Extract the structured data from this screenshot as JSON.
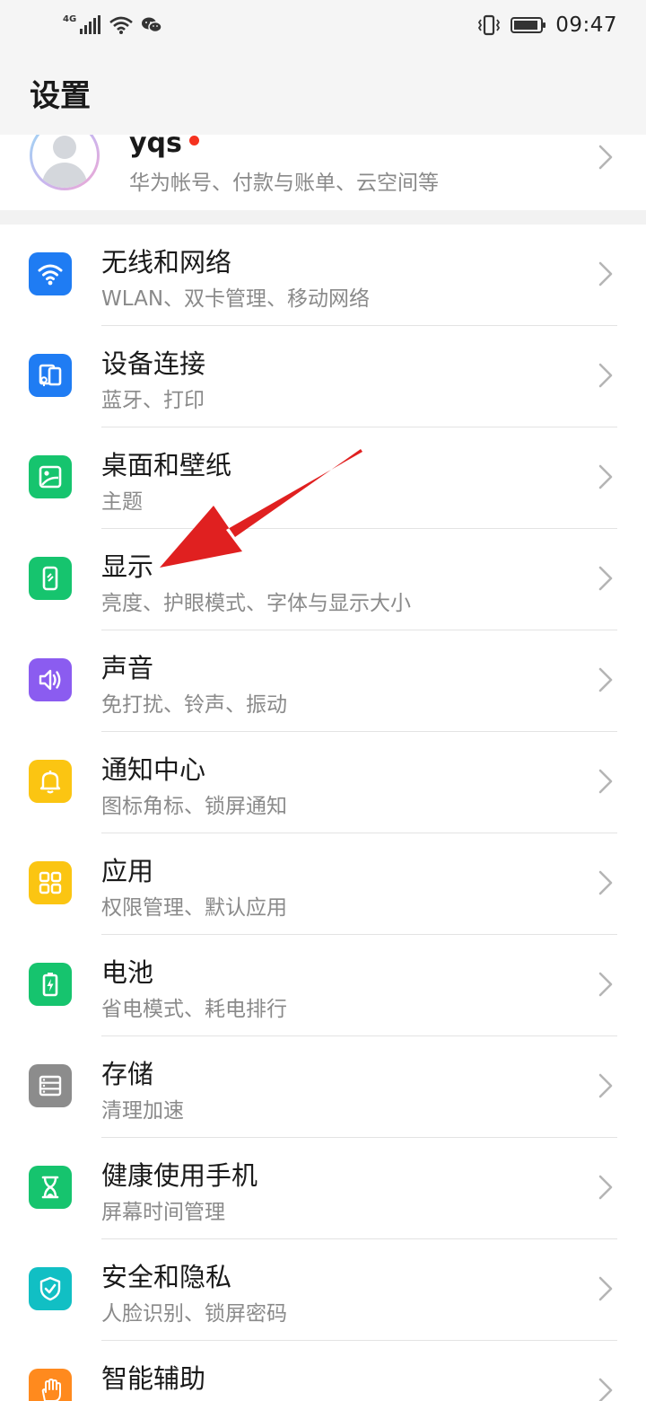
{
  "status_bar": {
    "network_label": "4G",
    "time": "09:47",
    "icons": [
      "signal-icon",
      "wifi-icon",
      "wechat-icon",
      "vibrate-icon",
      "battery-icon"
    ]
  },
  "header": {
    "title": "设置"
  },
  "account": {
    "name": "yqs",
    "subtitle": "华为帐号、付款与账单、云空间等",
    "has_notification_dot": true
  },
  "settings": [
    {
      "title": "无线和网络",
      "subtitle": "WLAN、双卡管理、移动网络",
      "icon": "wifi-icon",
      "color": "#1f7cf3"
    },
    {
      "title": "设备连接",
      "subtitle": "蓝牙、打印",
      "icon": "device-connect-icon",
      "color": "#1f7cf3"
    },
    {
      "title": "桌面和壁纸",
      "subtitle": "主题",
      "icon": "wallpaper-icon",
      "color": "#16c46e"
    },
    {
      "title": "显示",
      "subtitle": "亮度、护眼模式、字体与显示大小",
      "icon": "display-icon",
      "color": "#16c46e"
    },
    {
      "title": "声音",
      "subtitle": "免打扰、铃声、振动",
      "icon": "sound-icon",
      "color": "#8b5cf0"
    },
    {
      "title": "通知中心",
      "subtitle": "图标角标、锁屏通知",
      "icon": "notification-bell-icon",
      "color": "#fbc512"
    },
    {
      "title": "应用",
      "subtitle": "权限管理、默认应用",
      "icon": "apps-grid-icon",
      "color": "#fbc512"
    },
    {
      "title": "电池",
      "subtitle": "省电模式、耗电排行",
      "icon": "battery-charge-icon",
      "color": "#16c46e"
    },
    {
      "title": "存储",
      "subtitle": "清理加速",
      "icon": "storage-icon",
      "color": "#8c8c8c"
    },
    {
      "title": "健康使用手机",
      "subtitle": "屏幕时间管理",
      "icon": "hourglass-icon",
      "color": "#16c46e"
    },
    {
      "title": "安全和隐私",
      "subtitle": "人脸识别、锁屏密码",
      "icon": "shield-check-icon",
      "color": "#11bfc4"
    },
    {
      "title": "智能辅助",
      "subtitle": "",
      "icon": "hand-gesture-icon",
      "color": "#ff8a1e"
    }
  ],
  "annotation": {
    "color": "#e02020",
    "target": "显示"
  }
}
